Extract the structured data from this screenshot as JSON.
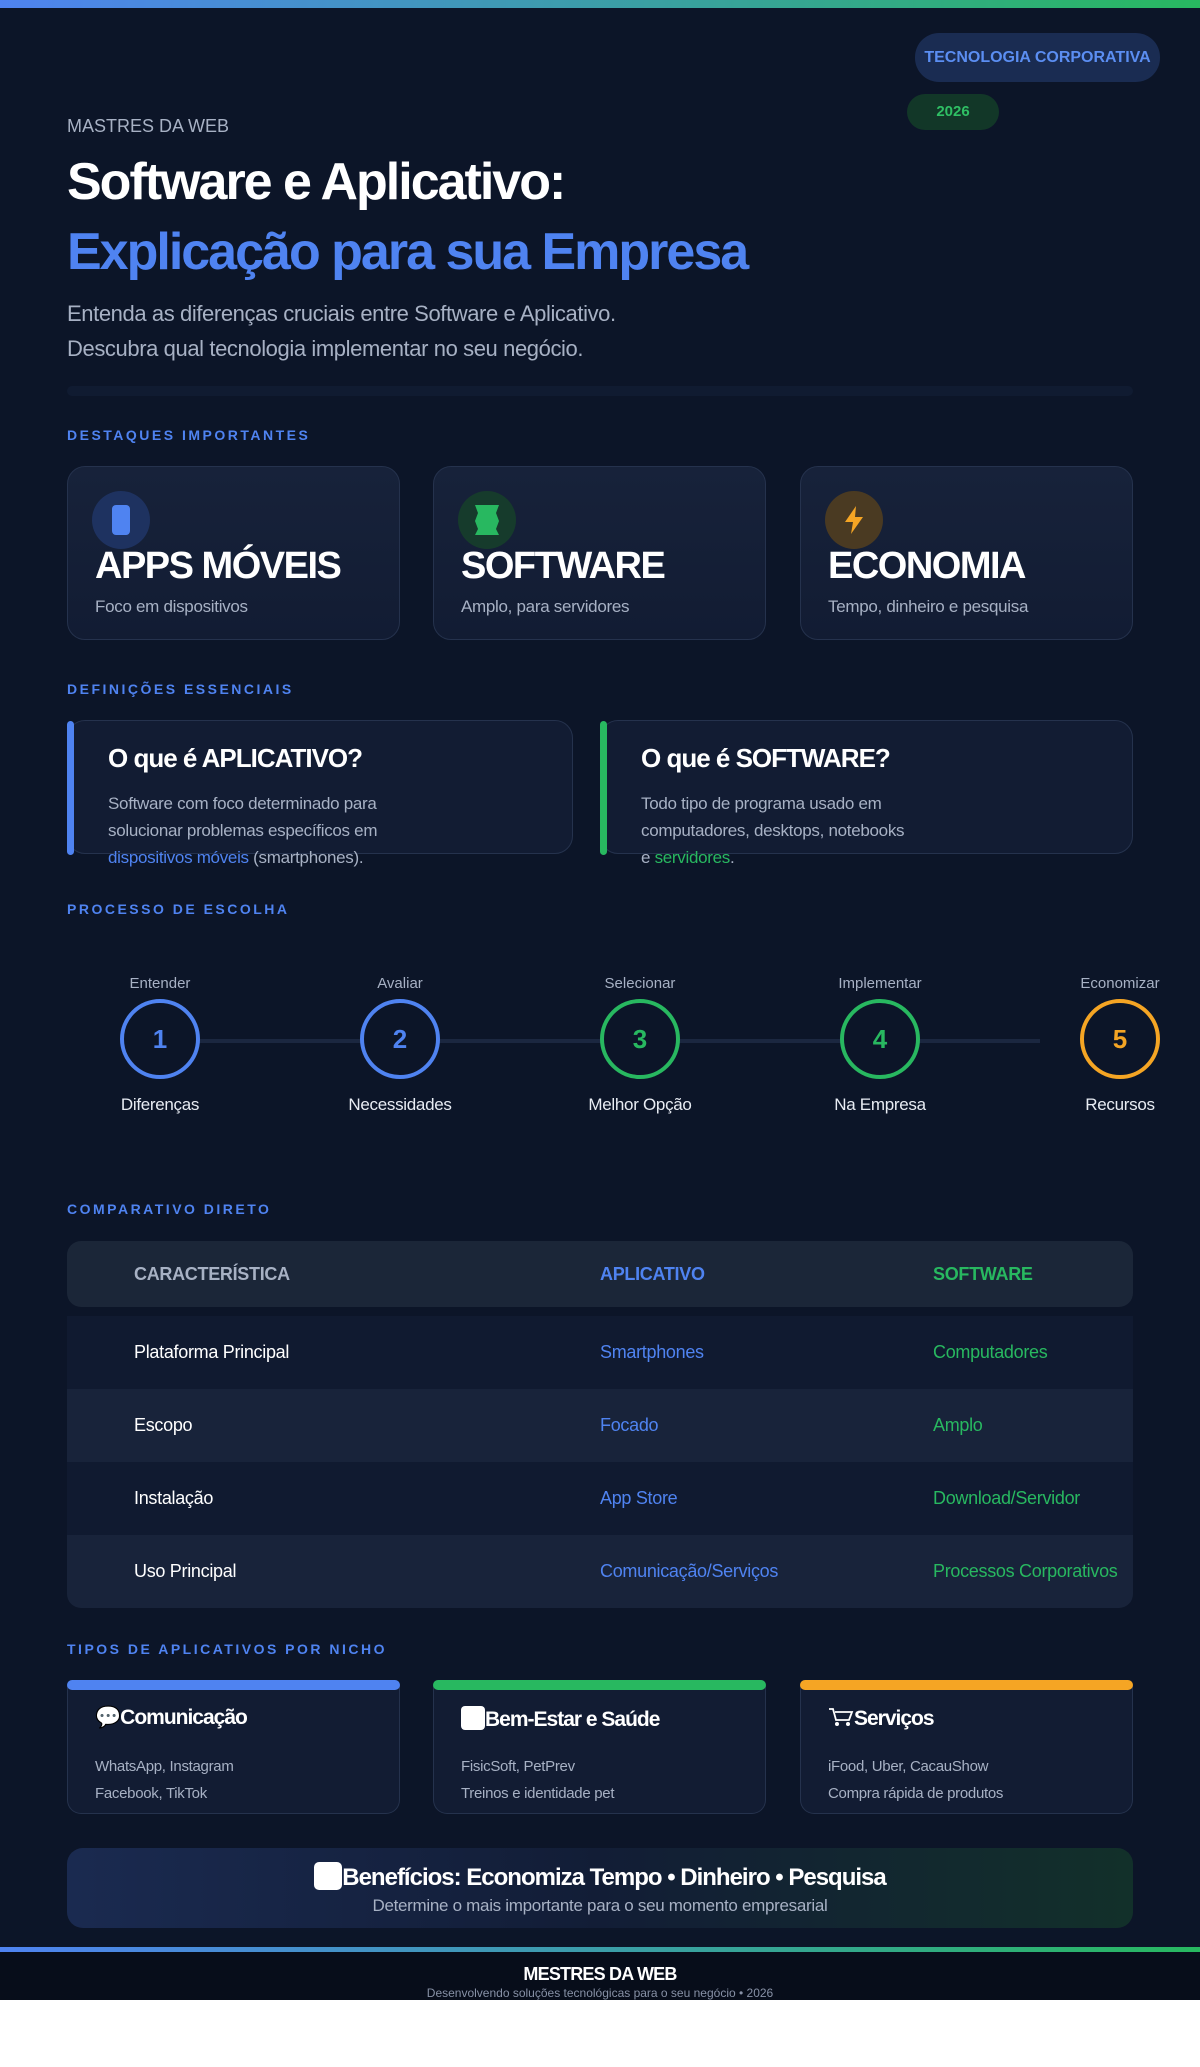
{
  "colors": {
    "blue": "#4f83f1",
    "green": "#28b860",
    "orange": "#f5a524",
    "bg": "#0c1528"
  },
  "header": {
    "badge_primary": "TECNOLOGIA CORPORATIVA",
    "badge_year": "2026",
    "brand": "MASTRES DA WEB",
    "title_line1": "Software e Aplicativo:",
    "title_line2": "Explicação para sua Empresa",
    "subtitle_line1": "Entenda as diferenças cruciais entre Software e Aplicativo.",
    "subtitle_line2": "Descubra qual tecnologia implementar no seu negócio."
  },
  "highlights": {
    "label": "DESTAQUES IMPORTANTES",
    "cards": [
      {
        "icon": "phone-icon",
        "title": "APPS MÓVEIS",
        "desc": "Foco em dispositivos"
      },
      {
        "icon": "server-icon",
        "title": "SOFTWARE",
        "desc": "Amplo, para servidores"
      },
      {
        "icon": "lightning-icon",
        "title": "ECONOMIA",
        "desc": "Tempo, dinheiro e pesquisa"
      }
    ]
  },
  "definitions": {
    "label": "DEFINIÇÕES ESSENCIAIS",
    "app": {
      "title": "O que é APLICATIVO?",
      "line1": "Software com foco determinado para",
      "line2": "solucionar problemas específicos em",
      "highlight": "dispositivos móveis",
      "tail": " (smartphones)."
    },
    "software": {
      "title": "O que é SOFTWARE?",
      "line1": "Todo tipo de programa usado em",
      "line2": "computadores, desktops, notebooks",
      "prefix": "e ",
      "highlight": "servidores",
      "tail": "."
    }
  },
  "process": {
    "label": "PROCESSO DE ESCOLHA",
    "steps": [
      {
        "top": "Entender",
        "num": "1",
        "bottom": "Diferenças"
      },
      {
        "top": "Avaliar",
        "num": "2",
        "bottom": "Necessidades"
      },
      {
        "top": "Selecionar",
        "num": "3",
        "bottom": "Melhor Opção"
      },
      {
        "top": "Implementar",
        "num": "4",
        "bottom": "Na Empresa"
      },
      {
        "top": "Economizar",
        "num": "5",
        "bottom": "Recursos"
      }
    ]
  },
  "comparison": {
    "label": "COMPARATIVO DIRETO",
    "headers": [
      "CARACTERÍSTICA",
      "APLICATIVO",
      "SOFTWARE"
    ],
    "rows": [
      [
        "Plataforma Principal",
        "Smartphones",
        "Computadores"
      ],
      [
        "Escopo",
        "Focado",
        "Amplo"
      ],
      [
        "Instalação",
        "App Store",
        "Download/Servidor"
      ],
      [
        "Uso Principal",
        "Comunicação/Serviços",
        "Processos Corporativos"
      ]
    ]
  },
  "niches": {
    "label": "TIPOS DE APLICATIVOS POR NICHO",
    "cards": [
      {
        "icon": "speech-bubble-icon",
        "title": "Comunicação",
        "line1": "WhatsApp, Instagram",
        "line2": "Facebook, TikTok"
      },
      {
        "icon": "health-icon",
        "title": "Bem-Estar e Saúde",
        "line1": "FisicSoft, PetPrev",
        "line2": "Treinos e identidade pet"
      },
      {
        "icon": "cart-icon",
        "title": "Serviços",
        "line1": "iFood, Uber, CacauShow",
        "line2": "Compra rápida de produtos"
      }
    ]
  },
  "benefits": {
    "icon": "benefits-icon",
    "title": "Benefícios: Economiza Tempo • Dinheiro • Pesquisa",
    "subtitle": "Determine o mais importante para o seu momento empresarial"
  },
  "footer": {
    "brand": "MESTRES DA WEB",
    "tagline": "Desenvolvendo soluções tecnológicas para o seu negócio • 2026"
  }
}
